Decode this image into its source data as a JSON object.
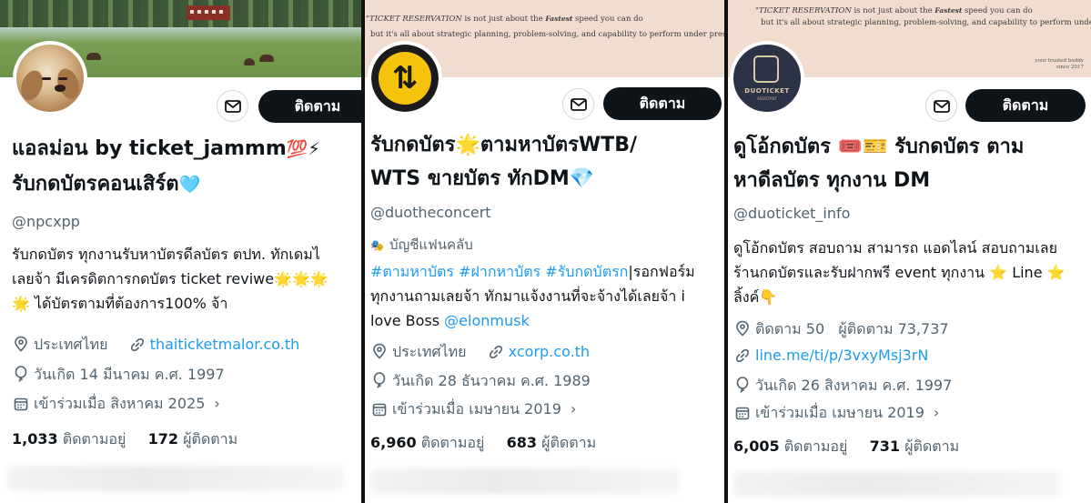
{
  "profiles": [
    {
      "banner_kind": "field photo",
      "avatar": "puppy-photo",
      "display_name": "แอลม่อน by ticket_jammm",
      "name_emojis": "💯⚡",
      "name_line2": "รับกดบัตรคอนเสิร์ต",
      "name_line2_emoji": "🩵",
      "handle": "@npcxpp",
      "bio_lines": [
        "รับกดบัตร ทุกงานรับหาบัตรดีลบัตร ตปท.  ทักเดมไ",
        "เลยจ้า  มีเครดิตการกดบัตร  ticket reviwe🌟🌟🌟",
        "🌟 ได้บัตรตามที่ต้องการ100% จ้า"
      ],
      "location": "ประเทศไทย",
      "website": "thaiticketmalor.co.th",
      "birthday": "วันเกิด 14 มีนาคม ค.ศ. 1997",
      "joined": "เข้าร่วมเมื่อ สิงหาคม 2025",
      "following_count": "1,033",
      "following_label": "ติดตามอยู่",
      "followers_count": "172",
      "followers_label": "ผู้ติดตาม",
      "follow_label": "ติดตาม"
    },
    {
      "banner_kind": "quote",
      "avatar": "retweet-logo",
      "display_name_line1": "รับกดบัตร🌟ตามหาบัตรWTB/",
      "display_name_line2": "WTS ขายบัตร ทักDM💎",
      "handle": "@duotheconcert",
      "account_type": "บัญชีแฟนคลับ",
      "bio_hashtags": "#ตามหาบัตร #ฝากหาบัตร #รับกดบัตรก",
      "bio_tail": "|รอกฟอร์ม",
      "bio_line2": "ทุกงานถามเลยจ้า ทักมาแจ้งงานที่จะจ้างได้เลยจ้า  i",
      "bio_line3_text": "love Boss ",
      "bio_mention": "@elonmusk",
      "location": "ประเทศไทย",
      "website": "xcorp.co.th",
      "birthday": "วันเกิด 28 ธันวาคม ค.ศ. 1989",
      "joined": "เข้าร่วมเมื่อ เมษายน 2019",
      "following_count": "6,960",
      "following_label": "ติดตามอยู่",
      "followers_count": "683",
      "followers_label": "ผู้ติดตาม",
      "follow_label": "ติดตาม"
    },
    {
      "banner_kind": "quote",
      "avatar": "duoticket-logo",
      "avatar_text": "DUOTICKET",
      "avatar_subtext": "ASSISTANT",
      "display_name_line1": "ดูโอ้กดบัตร 🎟️🎫 รับกดบัตร ตาม",
      "display_name_line2": "หาดีลบัตร ทุกงาน DM",
      "handle": "@duoticket_info",
      "bio_line1": "ดูโอ้กดบัตร สอบถาม สามารถ แอดไลน์ สอบถามเลย",
      "bio_line2": "ร้านกดบัตรและรับฝากพรี event ทุกงาน ⭐ Line ⭐",
      "bio_line3": "ลิ้งค์👇",
      "stats_line": "ติดตาม 50   ผู้ติดตาม 73,737",
      "website": "line.me/ti/p/3vxyMsj3rN",
      "birthday": "วันเกิด 26 สิงหาคม ค.ศ. 1997",
      "joined": "เข้าร่วมเมื่อ เมษายน 2019",
      "following_count": "6,005",
      "following_label": "ติดตามอยู่",
      "followers_count": "731",
      "followers_label": "ผู้ติดตาม",
      "follow_label": "ติดตาม"
    }
  ],
  "banner_quote": {
    "line1_a": "\"TICKET RESERVATION",
    "line1_b": " is not just about the ",
    "line1_script": "Fastest",
    "line1_c": " speed you can do",
    "line2": "but it's all about strategic planning, problem-solving, and capability to perform under pressure\"",
    "buddy_line1": "your trusted buddy",
    "buddy_line2": "since 2017"
  },
  "colors": {
    "link": "#1d9bf0",
    "secondary_text": "#536471",
    "follow_button": "#0f1419",
    "divider": "#111111"
  }
}
